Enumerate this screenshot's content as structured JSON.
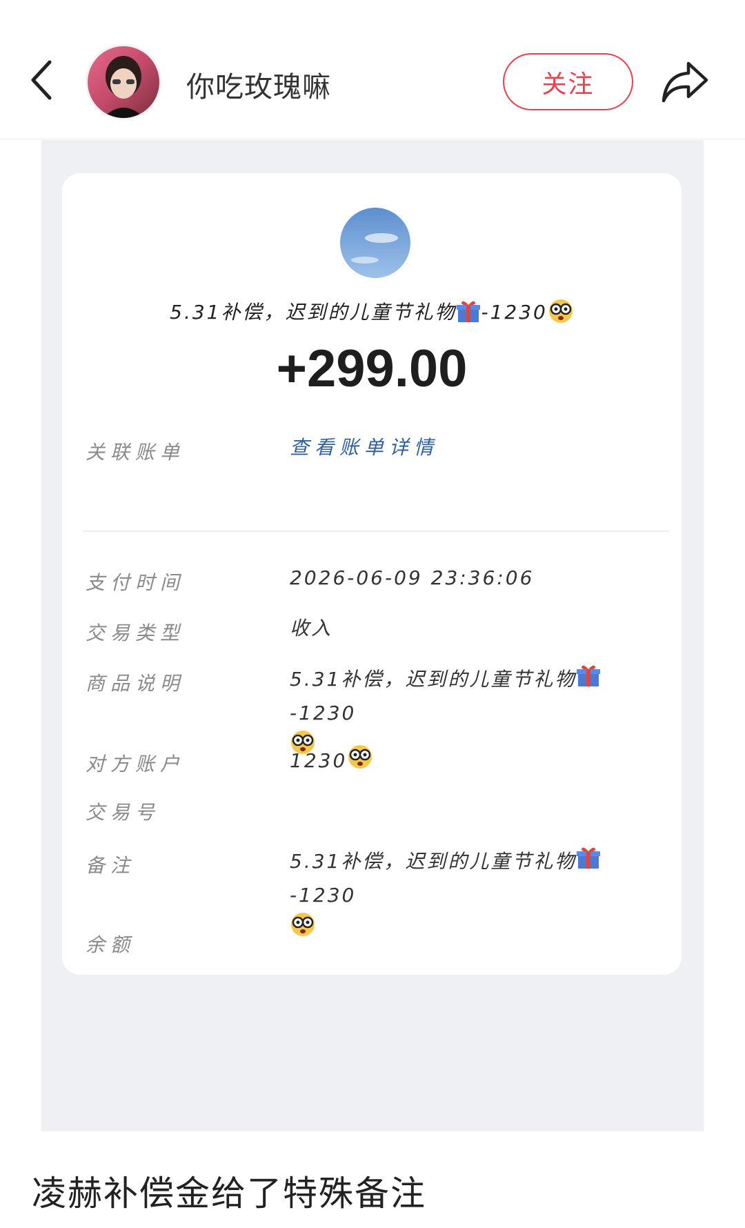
{
  "header": {
    "username": "你吃玫瑰嘛",
    "follow_label": "关注"
  },
  "receipt": {
    "title": "5.31补偿，迟到的儿童节礼物",
    "title_suffix": "-1230",
    "amount": "+299.00",
    "rows": [
      {
        "label": "关联账单",
        "value": "查看账单详情"
      },
      {
        "label": "支付时间",
        "value": "2026-06-09  23:36:06"
      },
      {
        "label": "交易类型",
        "value": "收入"
      },
      {
        "label": "商品说明",
        "value": "5.31补偿，迟到的儿童节礼物",
        "value_suffix": "-1230"
      },
      {
        "label": "对方账户",
        "value": "1230"
      },
      {
        "label": "交易号",
        "value": ""
      },
      {
        "label": "备注",
        "value": "5.31补偿，迟到的儿童节礼物",
        "value_suffix": "-1230"
      },
      {
        "label": "余额",
        "value": ""
      }
    ]
  },
  "caption": "凌赫补偿金给了特殊备注",
  "colors": {
    "accent": "#e8424e",
    "link": "#2f5f9e",
    "screenshot_bg": "#eef0f4"
  },
  "icons": [
    "back-arrow-icon",
    "share-icon",
    "gift-emoji-icon",
    "nerd-face-emoji-icon"
  ]
}
